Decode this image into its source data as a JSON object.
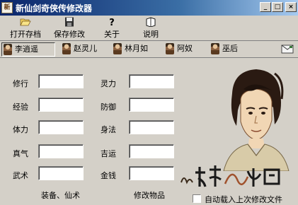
{
  "window": {
    "title": "新仙剑奇侠传修改器",
    "app_icon_glyph": "新",
    "controls": {
      "minimize": "_",
      "maximize": "□",
      "close": "×"
    }
  },
  "toolbar": {
    "items": [
      {
        "label": "打开存档",
        "icon": "open-folder-icon"
      },
      {
        "label": "保存修改",
        "icon": "floppy-disk-icon"
      },
      {
        "label": "关于",
        "icon": "question-icon"
      },
      {
        "label": "说明",
        "icon": "book-icon"
      }
    ]
  },
  "tabs": {
    "items": [
      {
        "label": "李逍遥",
        "active": true
      },
      {
        "label": "赵灵儿",
        "active": false
      },
      {
        "label": "林月如",
        "active": false
      },
      {
        "label": "阿奴",
        "active": false
      },
      {
        "label": "巫后",
        "active": false
      }
    ],
    "extra_icon": "envelope-icon"
  },
  "stats": {
    "left": [
      {
        "label": "修行",
        "value": ""
      },
      {
        "label": "经验",
        "value": ""
      },
      {
        "label": "体力",
        "value": ""
      },
      {
        "label": "真气",
        "value": ""
      },
      {
        "label": "武术",
        "value": ""
      }
    ],
    "right": [
      {
        "label": "灵力",
        "value": ""
      },
      {
        "label": "防御",
        "value": ""
      },
      {
        "label": "身法",
        "value": ""
      },
      {
        "label": "吉运",
        "value": ""
      },
      {
        "label": "金钱",
        "value": ""
      }
    ]
  },
  "bottom": {
    "equip_label": "装备、仙术",
    "items_label": "修改物品",
    "auto_load_label": "自动载入上次修改文件"
  },
  "colors": {
    "titlebar_start": "#0a246a",
    "titlebar_end": "#a6caf0",
    "face": "#d4d0c8"
  }
}
